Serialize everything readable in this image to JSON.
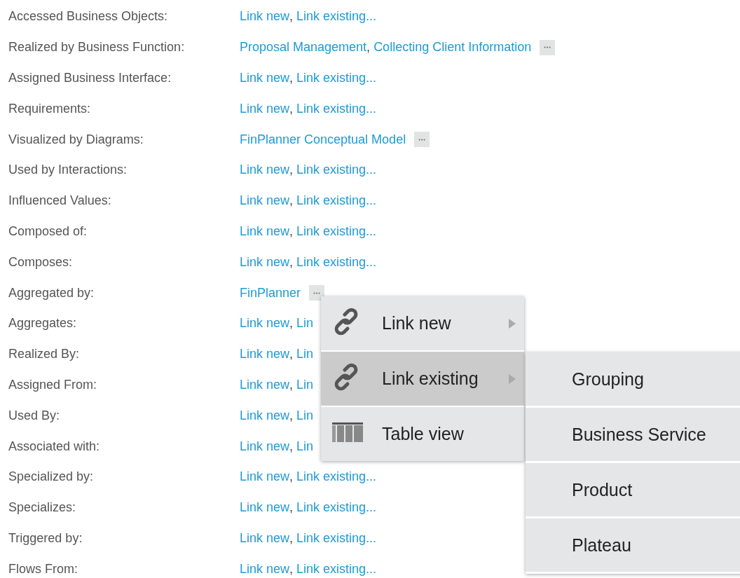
{
  "rows": [
    {
      "label": "Accessed Business Objects:",
      "values": [
        {
          "kind": "link",
          "text": "Link new"
        },
        {
          "kind": "separator",
          "text": ","
        },
        {
          "kind": "link",
          "text": "Link existing..."
        }
      ]
    },
    {
      "label": "Realized by Business Function:",
      "values": [
        {
          "kind": "link",
          "text": "Proposal Management"
        },
        {
          "kind": "separator",
          "text": ","
        },
        {
          "kind": "link",
          "text": "Collecting Client Information"
        },
        {
          "kind": "more"
        }
      ]
    },
    {
      "label": "Assigned Business Interface:",
      "values": [
        {
          "kind": "link",
          "text": "Link new"
        },
        {
          "kind": "separator",
          "text": ","
        },
        {
          "kind": "link",
          "text": "Link existing..."
        }
      ]
    },
    {
      "label": "Requirements:",
      "values": [
        {
          "kind": "link",
          "text": "Link new"
        },
        {
          "kind": "separator",
          "text": ","
        },
        {
          "kind": "link",
          "text": "Link existing..."
        }
      ]
    },
    {
      "label": "Visualized by Diagrams:",
      "values": [
        {
          "kind": "link",
          "text": "FinPlanner Conceptual Model"
        },
        {
          "kind": "more"
        }
      ]
    },
    {
      "label": "Used by Interactions:",
      "values": [
        {
          "kind": "link",
          "text": "Link new"
        },
        {
          "kind": "separator",
          "text": ","
        },
        {
          "kind": "link",
          "text": "Link existing..."
        }
      ]
    },
    {
      "label": "Influenced Values:",
      "values": [
        {
          "kind": "link",
          "text": "Link new"
        },
        {
          "kind": "separator",
          "text": ","
        },
        {
          "kind": "link",
          "text": "Link existing..."
        }
      ]
    },
    {
      "label": "Composed of:",
      "values": [
        {
          "kind": "link",
          "text": "Link new"
        },
        {
          "kind": "separator",
          "text": ","
        },
        {
          "kind": "link",
          "text": "Link existing..."
        }
      ]
    },
    {
      "label": "Composes:",
      "values": [
        {
          "kind": "link",
          "text": "Link new"
        },
        {
          "kind": "separator",
          "text": ","
        },
        {
          "kind": "link",
          "text": "Link existing..."
        }
      ]
    },
    {
      "label": "Aggregated by:",
      "values": [
        {
          "kind": "link",
          "text": "FinPlanner"
        },
        {
          "kind": "more"
        }
      ]
    },
    {
      "label": "Aggregates:",
      "values": [
        {
          "kind": "link",
          "text": "Link new"
        },
        {
          "kind": "separator",
          "text": ","
        },
        {
          "kind": "link",
          "text": "Lin"
        }
      ]
    },
    {
      "label": "Realized By:",
      "values": [
        {
          "kind": "link",
          "text": "Link new"
        },
        {
          "kind": "separator",
          "text": ","
        },
        {
          "kind": "link",
          "text": "Lin"
        }
      ]
    },
    {
      "label": "Assigned From:",
      "values": [
        {
          "kind": "link",
          "text": "Link new"
        },
        {
          "kind": "separator",
          "text": ","
        },
        {
          "kind": "link",
          "text": "Lin"
        }
      ]
    },
    {
      "label": "Used By:",
      "values": [
        {
          "kind": "link",
          "text": "Link new"
        },
        {
          "kind": "separator",
          "text": ","
        },
        {
          "kind": "link",
          "text": "Lin"
        }
      ]
    },
    {
      "label": "Associated with:",
      "values": [
        {
          "kind": "link",
          "text": "Link new"
        },
        {
          "kind": "separator",
          "text": ","
        },
        {
          "kind": "link",
          "text": "Lin"
        }
      ]
    },
    {
      "label": "Specialized by:",
      "values": [
        {
          "kind": "link",
          "text": "Link new"
        },
        {
          "kind": "separator",
          "text": ","
        },
        {
          "kind": "link",
          "text": "Link existing..."
        }
      ]
    },
    {
      "label": "Specializes:",
      "values": [
        {
          "kind": "link",
          "text": "Link new"
        },
        {
          "kind": "separator",
          "text": ","
        },
        {
          "kind": "link",
          "text": "Link existing..."
        }
      ]
    },
    {
      "label": "Triggered by:",
      "values": [
        {
          "kind": "link",
          "text": "Link new"
        },
        {
          "kind": "separator",
          "text": ","
        },
        {
          "kind": "link",
          "text": "Link existing..."
        }
      ]
    },
    {
      "label": "Flows From:",
      "values": [
        {
          "kind": "link",
          "text": "Link new"
        },
        {
          "kind": "separator",
          "text": ","
        },
        {
          "kind": "link",
          "text": "Link existing..."
        }
      ]
    }
  ],
  "context_menu": {
    "items": [
      {
        "label": "Link new",
        "kind": "link",
        "has_submenu": true,
        "selected": false
      },
      {
        "label": "Link existing",
        "kind": "link",
        "has_submenu": true,
        "selected": true
      },
      {
        "label": "Table view",
        "kind": "table",
        "has_submenu": false,
        "selected": false
      }
    ],
    "submenu": {
      "items": [
        {
          "label": "Grouping"
        },
        {
          "label": "Business Service"
        },
        {
          "label": "Product"
        },
        {
          "label": "Plateau"
        }
      ]
    }
  }
}
